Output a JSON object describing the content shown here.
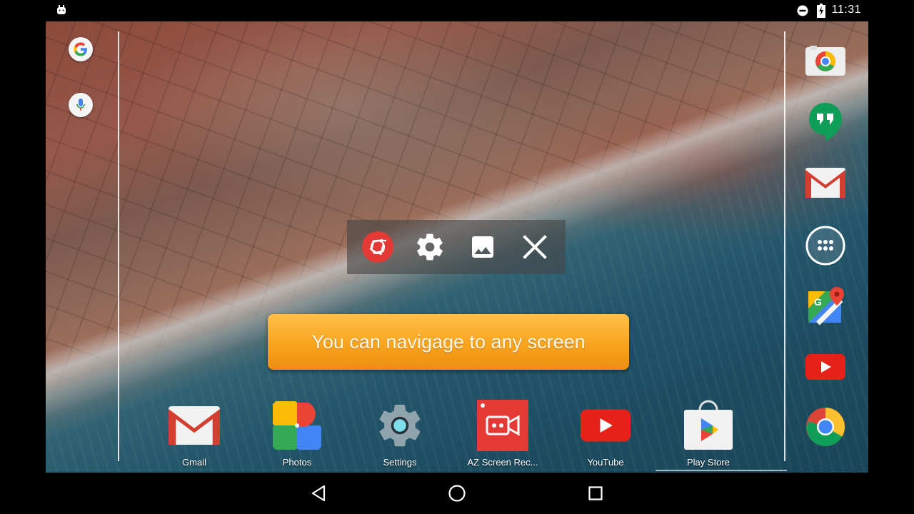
{
  "status_bar": {
    "time": "11:31",
    "icons": [
      "android-debug-icon",
      "do-not-disturb-icon",
      "battery-charging-icon"
    ]
  },
  "left_quick": [
    "google-search-icon",
    "voice-search-icon"
  ],
  "right_dock": [
    "camera-icon",
    "hangouts-icon",
    "gmail-icon",
    "all-apps-icon",
    "maps-icon",
    "youtube-icon",
    "chrome-icon"
  ],
  "floating_toolbar": [
    "record-icon",
    "settings-icon",
    "image-gallery-icon",
    "close-icon"
  ],
  "toast": {
    "text": "You can navigage to any screen"
  },
  "bottom_dock": [
    {
      "label": "Gmail",
      "icon": "gmail-icon"
    },
    {
      "label": "Photos",
      "icon": "photos-icon"
    },
    {
      "label": "Settings",
      "icon": "settings-app-icon"
    },
    {
      "label": "AZ Screen Rec...",
      "icon": "az-screen-recorder-icon"
    },
    {
      "label": "YouTube",
      "icon": "youtube-icon"
    },
    {
      "label": "Play Store",
      "icon": "play-store-icon"
    }
  ],
  "nav_bar": [
    "back-icon",
    "home-icon",
    "recents-icon"
  ],
  "colors": {
    "toast_orange": "#f8a41f",
    "record_red": "#e53935",
    "gmail_red": "#d23f31",
    "youtube_red": "#e62117"
  }
}
